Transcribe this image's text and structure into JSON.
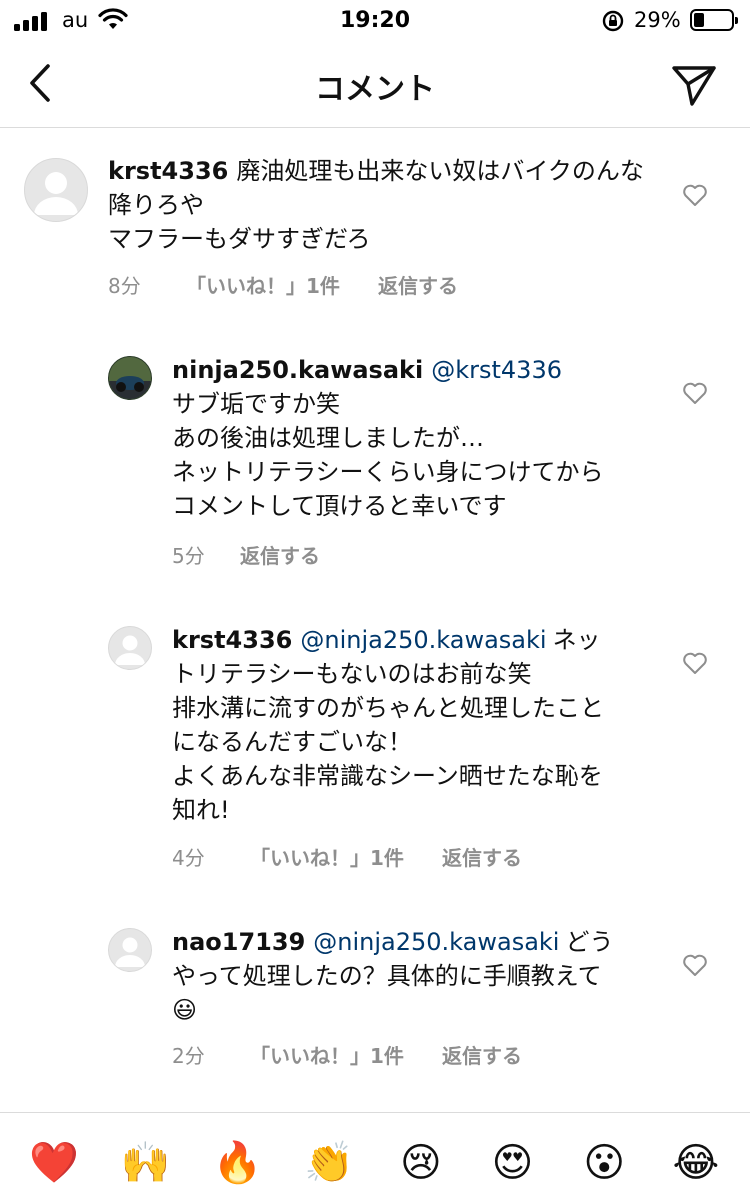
{
  "status_bar": {
    "carrier": "au",
    "time": "19:20",
    "battery_pct": "29%",
    "battery_level": 0.29
  },
  "nav": {
    "title": "コメント",
    "back_icon": "chevron-left-icon",
    "send_icon": "paper-plane-icon"
  },
  "comments": [
    {
      "username": "krst4336",
      "mention": "",
      "text": "廃油処理も出来ない奴はバイクのんな降りろや\nマフラーもダサすぎだろ",
      "time_ago": "8分",
      "likes": "「いいね！」1件",
      "reply": "返信する"
    },
    {
      "username": "ninja250.kawasaki",
      "mention": "@krst4336",
      "text": "サブ垢ですか笑\nあの後油は処理しましたが…\nネットリテラシーくらい身につけてからコメントして頂けると幸いです",
      "time_ago": "5分",
      "likes": "",
      "reply": "返信する"
    },
    {
      "username": "krst4336",
      "mention": "@ninja250.kawasaki",
      "text": "ネットリテラシーもないのはお前な笑\n排水溝に流すのがちゃんと処理したことになるんだすごいな！\nよくあんな非常識なシーン晒せたな恥を知れ!",
      "time_ago": "4分",
      "likes": "「いいね！」1件",
      "reply": "返信する"
    },
    {
      "username": "nao17139",
      "mention": "@ninja250.kawasaki",
      "text": "どうやって処理したの？具体的に手順教えて😃",
      "time_ago": "2分",
      "likes": "「いいね！」1件",
      "reply": "返信する"
    }
  ],
  "emoji_bar": [
    "❤️",
    "🙌",
    "🔥",
    "👏",
    "😢",
    "😍",
    "😮",
    "😂"
  ],
  "colors": {
    "mention": "#00376b",
    "meta": "#8e8e8e",
    "divider": "#dbdbdb"
  }
}
